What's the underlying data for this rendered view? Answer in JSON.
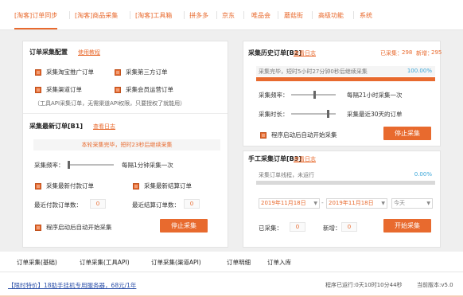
{
  "nav": {
    "tabs": [
      "[淘客]订单同步",
      "[淘客]商品采集",
      "[淘客]工具箱",
      "拼多多",
      "京东",
      "唯品会",
      "蘑菇街",
      "高级功能",
      "系统"
    ]
  },
  "order_config": {
    "title": "订单采集配置",
    "link": "使用教程",
    "options": [
      "采集淘宝推广订单",
      "采集第三方订单",
      "采集渠道订单",
      "采集会员运营订单"
    ],
    "note": "（工具API采集订单，无需渠道API权限，只要授权了就能用）"
  },
  "latest": {
    "title": "采集最新订单[B1]",
    "link": "查看日志",
    "banner": "本轮采集完毕，短时23秒后继续采集",
    "freq_label": "采集频率：",
    "freq_value": "每隔1分钟采集一次",
    "cb_pay": "采集最新付款订单",
    "cb_settle": "采集最新结算订单",
    "pay_count_label": "最近付款订单数：",
    "pay_count": "0",
    "settle_count_label": "最近结算订单数：",
    "settle_count": "0",
    "autostart": "程序启动后自动开始采集",
    "stop": "停止采集"
  },
  "history": {
    "title": "采集历史订单[B2]",
    "link": "查看日志",
    "collected_label": "已采集：",
    "collected": "298",
    "new_label": "新增：",
    "new": "295",
    "progress_text": "采集完毕，短时5小时27分钟0秒后继续采集",
    "progress_pct": "100.00%",
    "progress_fraction": 1.0,
    "freq_label": "采集频率：",
    "freq_value": "每隔21小时采集一次",
    "dur_label": "采集时长：",
    "dur_value": "采集最近30天的订单",
    "autostart": "程序启动后自动开始采集",
    "stop": "停止采集"
  },
  "manual": {
    "title": "手工采集订单[B3]",
    "link": "查看日志",
    "progress_text": "采集订单线程，未运行",
    "progress_pct": "0.00%",
    "progress_fraction": 0.0,
    "date_from": "2019年11月18日",
    "date_to": "2019年11月18日",
    "range": "今天",
    "collected_label": "已采集：",
    "collected": "0",
    "new_label": "新增：",
    "new": "0",
    "start": "开始采集"
  },
  "bottom_tabs": [
    "订单采集(基础)",
    "订单采集(工具API)",
    "订单采集(渠道API)",
    "订单明细",
    "订单入库"
  ],
  "footer": {
    "promo": "【限时特价】18助手挂机专用服务器，68元/1年",
    "runtime": "程序已运行:0天10时10分44秒",
    "version": "当前版本:v5.0"
  }
}
